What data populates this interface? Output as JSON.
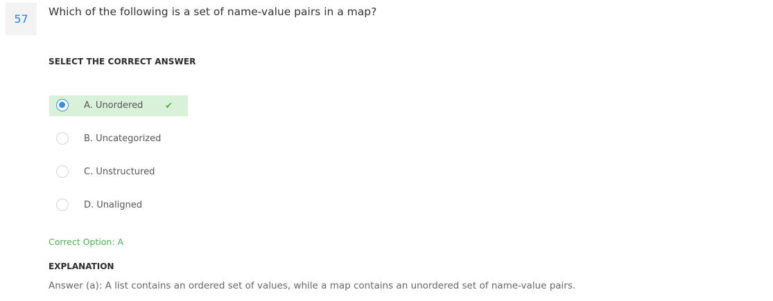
{
  "question": {
    "number": "57",
    "text": "Which of the following is a set of name-value pairs in a map?"
  },
  "select_label": "SELECT THE CORRECT ANSWER",
  "options": [
    {
      "label": "A. Unordered",
      "selected": true,
      "correct": true
    },
    {
      "label": "B. Uncategorized",
      "selected": false,
      "correct": false
    },
    {
      "label": "C. Unstructured",
      "selected": false,
      "correct": false
    },
    {
      "label": "D. Unaligned",
      "selected": false,
      "correct": false
    }
  ],
  "correct_option": "Correct Option: A",
  "explanation": {
    "title": "EXPLANATION",
    "text": "Answer (a): A list contains an ordered set of values, while a map contains an unordered set of name-value pairs."
  },
  "colors": {
    "accent": "#2f7fd8",
    "correct_green": "#4caf50",
    "selected_bg": "#d9f0d9"
  },
  "icons": {
    "correct_mark": "check-icon"
  }
}
